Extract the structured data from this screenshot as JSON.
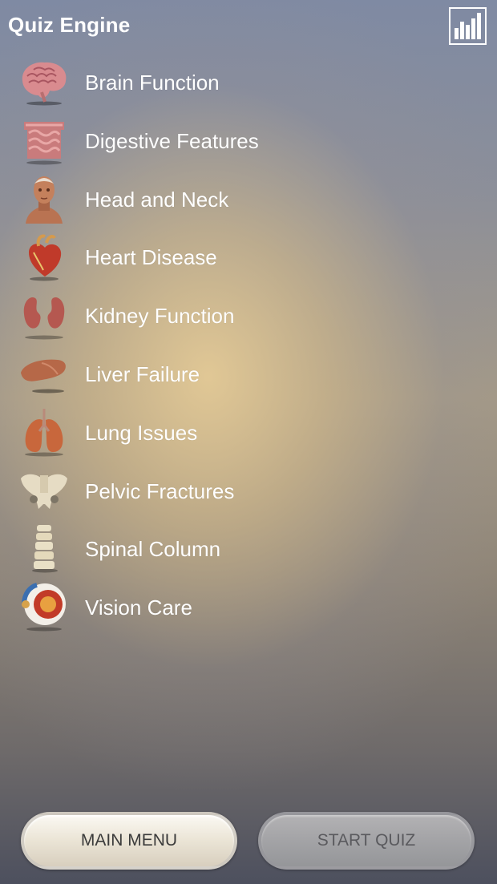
{
  "header": {
    "title": "Quiz Engine",
    "stats_icon": "bar-chart-icon"
  },
  "topics": [
    {
      "label": "Brain Function",
      "icon": "brain-icon"
    },
    {
      "label": "Digestive Features",
      "icon": "intestines-icon"
    },
    {
      "label": "Head and Neck",
      "icon": "head-icon"
    },
    {
      "label": "Heart Disease",
      "icon": "heart-icon"
    },
    {
      "label": "Kidney Function",
      "icon": "kidneys-icon"
    },
    {
      "label": "Liver Failure",
      "icon": "liver-icon"
    },
    {
      "label": "Lung Issues",
      "icon": "lungs-icon"
    },
    {
      "label": "Pelvic Fractures",
      "icon": "pelvis-icon"
    },
    {
      "label": "Spinal Column",
      "icon": "spine-icon"
    },
    {
      "label": "Vision Care",
      "icon": "eye-icon"
    }
  ],
  "footer": {
    "main_menu_label": "MAIN MENU",
    "start_quiz_label": "START QUIZ"
  },
  "colors": {
    "title_text": "#ffffff",
    "button_light": "#ece6d8",
    "button_disabled": "#a3a3a6"
  }
}
